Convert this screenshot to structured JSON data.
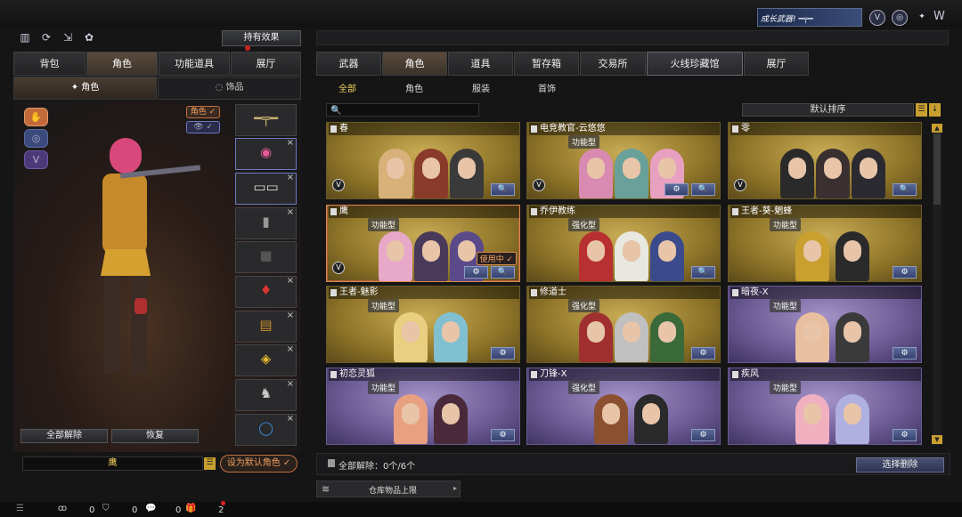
{
  "top_banner": {
    "text": "成长武器!"
  },
  "top_icons": [
    "shield-v-icon",
    "globe-icon",
    "wings-icon"
  ],
  "left_icons": [
    "store-icon",
    "refresh-icon",
    "arrows-icon",
    "gift-icon"
  ],
  "holding_effect_label": "持有效果",
  "left_tabs": [
    "背包",
    "角色",
    "功能道具",
    "展厅"
  ],
  "left_active_tab": 1,
  "left_subtabs": [
    {
      "label": "角色",
      "icon": "character-icon"
    },
    {
      "label": "饰品",
      "icon": "ring-icon"
    }
  ],
  "char_toggles": [
    "角色 ✓",
    "👁 ✓"
  ],
  "slot_items": [
    "sniper-rifle",
    "pink-helmet",
    "goggles",
    "radio",
    "dark-item",
    "red-drop",
    "ammo-box",
    "gold-ring",
    "horse-emblem",
    "blue-ring"
  ],
  "left_buttons": {
    "release_all": "全部解除",
    "restore": "恢复"
  },
  "bottom_name_input": "鹰",
  "set_default_label": "设为默认角色 ✓",
  "main_tabs": [
    "武器",
    "角色",
    "道具",
    "暂存箱",
    "交易所",
    "火线珍藏馆",
    "展厅"
  ],
  "main_active_tab": 1,
  "filter_tabs": [
    "全部",
    "角色",
    "服装",
    "首饰"
  ],
  "filter_active": 0,
  "search_placeholder": "",
  "sort_label": "默认排序",
  "cards": [
    {
      "name": "春",
      "tag": "",
      "theme": "gold",
      "v": true,
      "gear": false,
      "inuse": false
    },
    {
      "name": "电竞教官-云悠悠",
      "tag": "功能型",
      "theme": "gold",
      "v": true,
      "gear": true,
      "inuse": false
    },
    {
      "name": "零",
      "tag": "",
      "theme": "gold",
      "v": true,
      "gear": false,
      "inuse": false
    },
    {
      "name": "鹰",
      "tag": "功能型",
      "theme": "gold",
      "v": true,
      "gear": true,
      "inuse": true
    },
    {
      "name": "乔伊教练",
      "tag": "强化型",
      "theme": "gold",
      "v": false,
      "gear": false,
      "inuse": false
    },
    {
      "name": "王者-葵-魍蜂",
      "tag": "功能型",
      "theme": "gold",
      "v": false,
      "gear": true,
      "inuse": false
    },
    {
      "name": "王者-魅影",
      "tag": "功能型",
      "theme": "gold",
      "v": false,
      "gear": true,
      "inuse": false
    },
    {
      "name": "修道士",
      "tag": "强化型",
      "theme": "gold",
      "v": false,
      "gear": true,
      "inuse": false
    },
    {
      "name": "暗夜-X",
      "tag": "功能型",
      "theme": "purple",
      "v": false,
      "gear": true,
      "inuse": false
    },
    {
      "name": "初恋灵狐",
      "tag": "功能型",
      "theme": "purple",
      "v": false,
      "gear": true,
      "inuse": false
    },
    {
      "name": "刀锋-X",
      "tag": "强化型",
      "theme": "purple",
      "v": false,
      "gear": true,
      "inuse": false
    },
    {
      "name": "疾风",
      "tag": "功能型",
      "theme": "purple",
      "v": false,
      "gear": true,
      "inuse": false
    }
  ],
  "inuse_label": "使用中 ✓",
  "release_status": "全部解除：0个/6个",
  "select_delete_label": "选择删除",
  "warehouse_label": "仓库物品上限",
  "status_bar": {
    "count1": "0",
    "count2": "0",
    "count3": "0",
    "count4": "2"
  }
}
